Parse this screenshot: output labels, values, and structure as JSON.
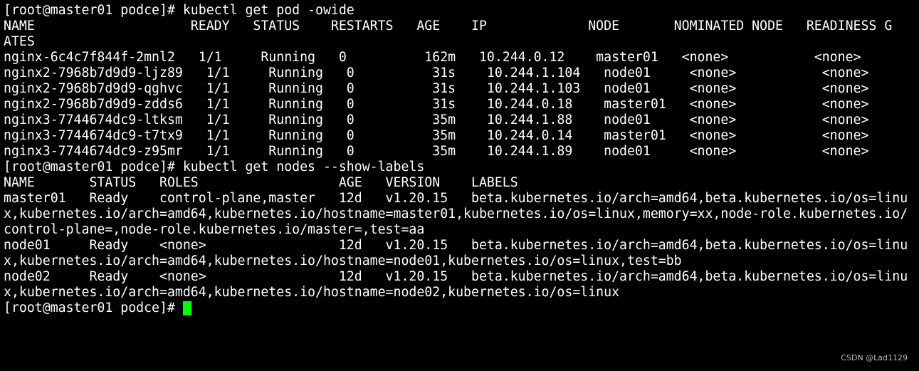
{
  "terminal": {
    "lines": [
      "[root@master01 podce]# kubectl get pod -owide",
      "NAME                    READY   STATUS    RESTARTS   AGE    IP             NODE       NOMINATED NODE   READINESS G",
      "ATES",
      "nginx-6c4c7f844f-2mnl2   1/1     Running   0          162m   10.244.0.12    master01   <none>           <none>",
      "nginx2-7968b7d9d9-ljz89   1/1     Running   0          31s    10.244.1.104   node01     <none>           <none>",
      "nginx2-7968b7d9d9-qghvc   1/1     Running   0          31s    10.244.1.103   node01     <none>           <none>",
      "nginx2-7968b7d9d9-zdds6   1/1     Running   0          31s    10.244.0.18    master01   <none>           <none>",
      "nginx3-7744674dc9-ltksm   1/1     Running   0          35m    10.244.1.88    node01     <none>           <none>",
      "nginx3-7744674dc9-t7tx9   1/1     Running   0          35m    10.244.0.14    master01   <none>           <none>",
      "nginx3-7744674dc9-z95mr   1/1     Running   0          35m    10.244.1.89    node01     <none>           <none>",
      "[root@master01 podce]# kubectl get nodes --show-labels",
      "NAME       STATUS   ROLES                  AGE   VERSION    LABELS",
      "master01   Ready    control-plane,master   12d   v1.20.15   beta.kubernetes.io/arch=amd64,beta.kubernetes.io/os=linu",
      "x,kubernetes.io/arch=amd64,kubernetes.io/hostname=master01,kubernetes.io/os=linux,memory=xx,node-role.kubernetes.io/",
      "control-plane=,node-role.kubernetes.io/master=,test=aa",
      "node01     Ready    <none>                 12d   v1.20.15   beta.kubernetes.io/arch=amd64,beta.kubernetes.io/os=linu",
      "x,kubernetes.io/arch=amd64,kubernetes.io/hostname=node01,kubernetes.io/os=linux,test=bb",
      "node02     Ready    <none>                 12d   v1.20.15   beta.kubernetes.io/arch=amd64,beta.kubernetes.io/os=linu",
      "x,kubernetes.io/arch=amd64,kubernetes.io/hostname=node02,kubernetes.io/os=linux",
      "[root@master01 podce]# "
    ]
  },
  "watermark": "CSDN @Lad1129",
  "colors": {
    "background": "#000000",
    "text": "#ffffff",
    "cursor": "#00ff00",
    "watermark": "#bdbdbd"
  }
}
